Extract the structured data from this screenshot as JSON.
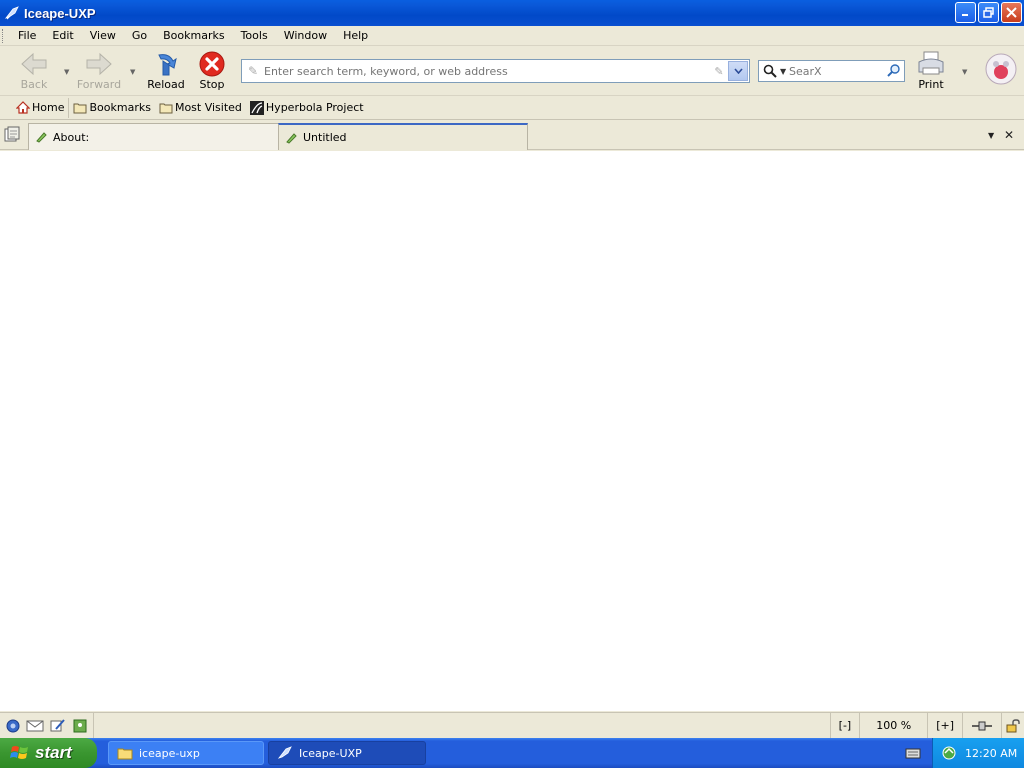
{
  "window": {
    "title": "Iceape-UXP"
  },
  "menu": [
    "File",
    "Edit",
    "View",
    "Go",
    "Bookmarks",
    "Tools",
    "Window",
    "Help"
  ],
  "nav": {
    "back": "Back",
    "forward": "Forward",
    "reload": "Reload",
    "stop": "Stop",
    "print": "Print"
  },
  "urlbar": {
    "placeholder": "Enter search term, keyword, or web address",
    "value": ""
  },
  "search": {
    "engine": "SearX"
  },
  "bookmarks": [
    "Home",
    "Bookmarks",
    "Most Visited",
    "Hyperbola Project"
  ],
  "tabs": [
    {
      "label": "About:",
      "active": false
    },
    {
      "label": "Untitled",
      "active": true
    }
  ],
  "status": {
    "minus": "[-]",
    "zoom": "100 %",
    "plus": "[+]"
  },
  "taskbar": {
    "start": "start",
    "tasks": [
      "iceape-uxp",
      "Iceape-UXP"
    ],
    "clock": "12:20 AM"
  },
  "colors": {
    "titlebar": "#0149c8",
    "taskbar": "#245edc",
    "start": "#3a9630"
  }
}
